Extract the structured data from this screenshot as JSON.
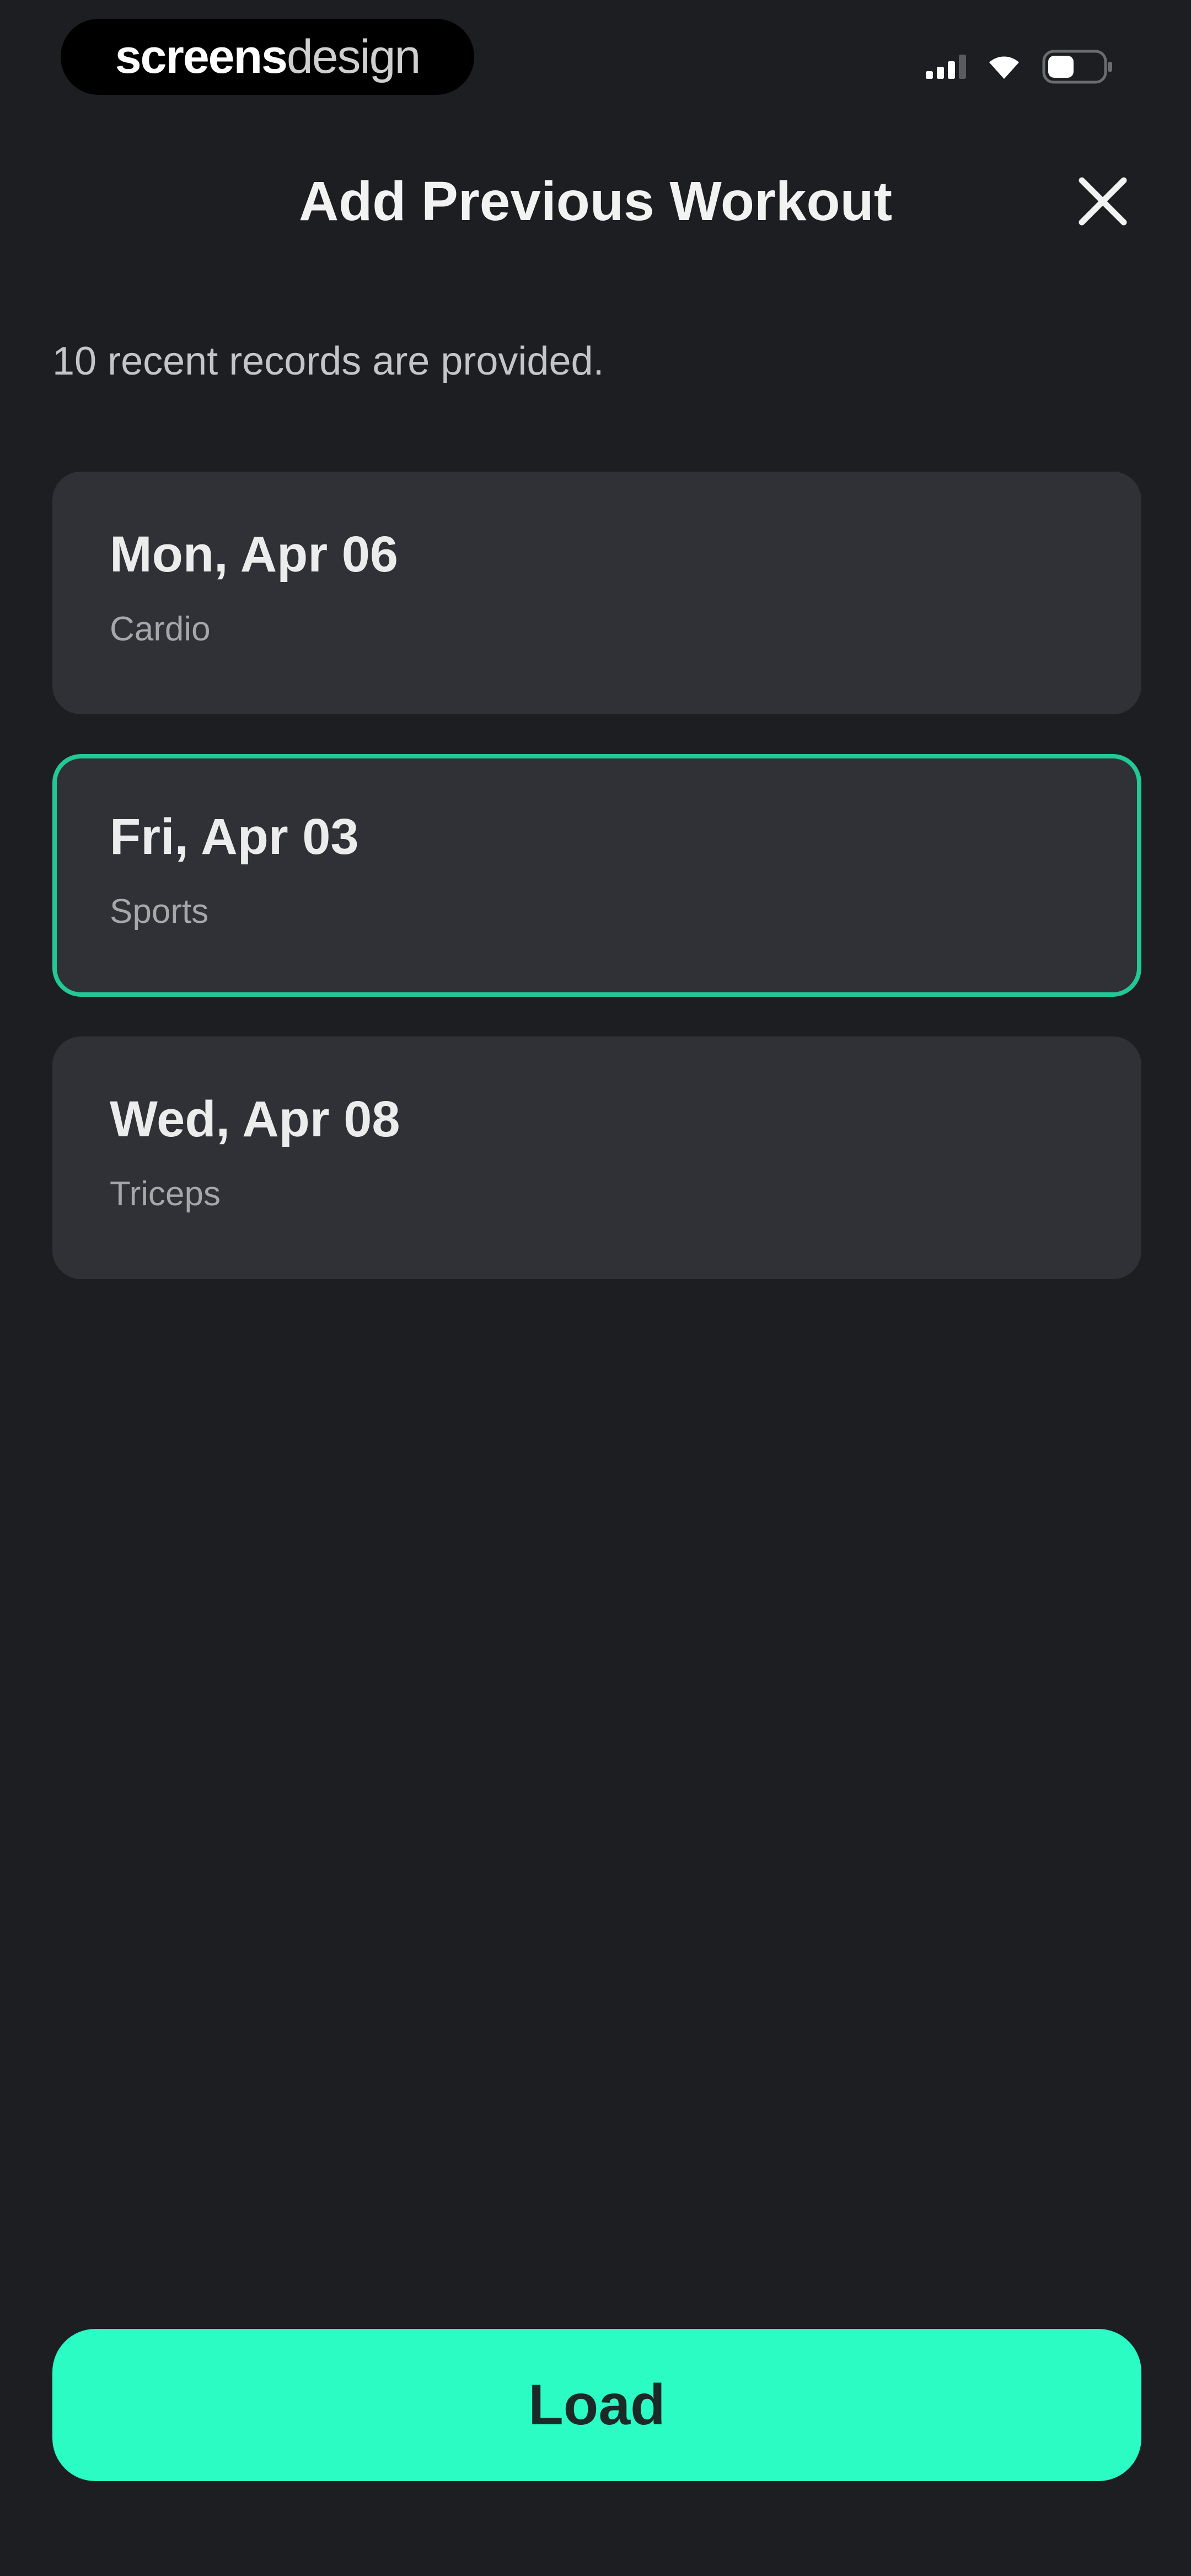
{
  "status_bar": {
    "brand_bold": "screens",
    "brand_light": "design",
    "icons": [
      "cellular-signal-icon",
      "wifi-icon",
      "battery-icon"
    ]
  },
  "header": {
    "title": "Add Previous Workout",
    "close_icon": "close-icon"
  },
  "subtitle": "10 recent records are provided.",
  "records": [
    {
      "date": "Mon, Apr 06",
      "type": "Cardio",
      "selected": false
    },
    {
      "date": "Fri, Apr 03",
      "type": "Sports",
      "selected": true
    },
    {
      "date": "Wed, Apr 08",
      "type": "Triceps",
      "selected": false
    }
  ],
  "load_button": {
    "label": "Load"
  },
  "colors": {
    "background": "#1d1e21",
    "card": "#303136",
    "selected_border": "#22c896",
    "accent": "#2afcc4"
  }
}
